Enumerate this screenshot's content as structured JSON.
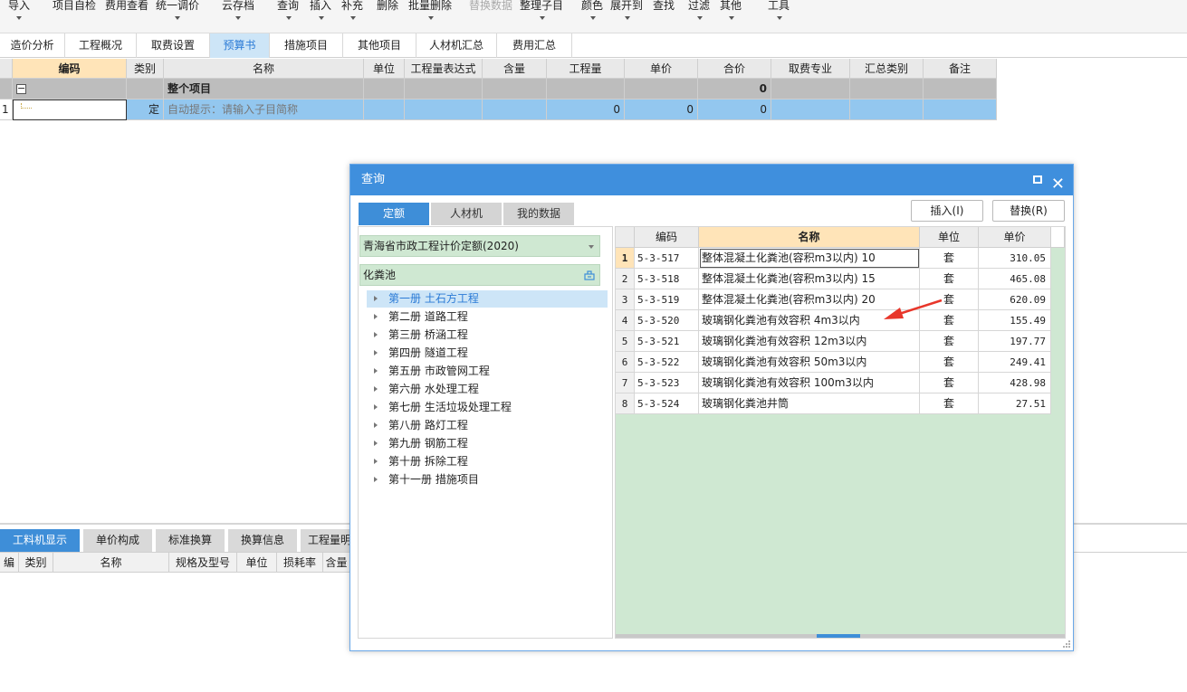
{
  "toolbar": {
    "items": [
      {
        "label": "导入",
        "caret": true
      },
      {
        "label": "项目自检",
        "caret": false
      },
      {
        "label": "费用查看",
        "caret": false
      },
      {
        "label": "统一调价",
        "caret": true
      },
      {
        "label": "云存档",
        "caret": true
      },
      {
        "label": "查询",
        "caret": true
      },
      {
        "label": "插入",
        "caret": true
      },
      {
        "label": "补充",
        "caret": true
      },
      {
        "label": "删除",
        "caret": false
      },
      {
        "label": "批量删除",
        "caret": true
      },
      {
        "label": "替换数据",
        "caret": false,
        "disabled": true
      },
      {
        "label": "整理子目",
        "caret": true
      },
      {
        "label": "颜色",
        "caret": true
      },
      {
        "label": "展开到",
        "caret": true
      },
      {
        "label": "查找",
        "caret": false
      },
      {
        "label": "过滤",
        "caret": true
      },
      {
        "label": "其他",
        "caret": true
      },
      {
        "label": "工具",
        "caret": true
      }
    ]
  },
  "tabs": [
    {
      "label": "造价分析"
    },
    {
      "label": "工程概况"
    },
    {
      "label": "取费设置"
    },
    {
      "label": "预算书",
      "active": true
    },
    {
      "label": "措施项目"
    },
    {
      "label": "其他项目"
    },
    {
      "label": "人材机汇总"
    },
    {
      "label": "费用汇总"
    }
  ],
  "grid": {
    "headers": [
      "编码",
      "类别",
      "名称",
      "单位",
      "工程量表达式",
      "含量",
      "工程量",
      "单价",
      "合价",
      "取费专业",
      "汇总类别",
      "备注"
    ],
    "root_row": {
      "collapse": "−",
      "name": "整个项目",
      "total": "0"
    },
    "row1": {
      "no": "1",
      "type": "定",
      "name": "自动提示：请输入子目简称",
      "qty": "0",
      "price": "0",
      "total": "0"
    }
  },
  "bottom": {
    "tabs": [
      {
        "label": "工料机显示",
        "active": true
      },
      {
        "label": "单价构成"
      },
      {
        "label": "标准换算"
      },
      {
        "label": "换算信息"
      },
      {
        "label": "工程量明细"
      }
    ],
    "headers": [
      "编码",
      "类别",
      "名称",
      "规格及型号",
      "单位",
      "损耗率",
      "含量"
    ]
  },
  "dialog": {
    "title": "查询",
    "tabs": [
      {
        "label": "定额",
        "active": true
      },
      {
        "label": "人材机"
      },
      {
        "label": "我的数据"
      }
    ],
    "insert_btn": "插入(I)",
    "replace_btn": "替换(R)",
    "library": "青海省市政工程计价定额(2020)",
    "search_value": "化粪池",
    "tree": [
      {
        "label": "第一册 土石方工程",
        "selected": true
      },
      {
        "label": "第二册 道路工程"
      },
      {
        "label": "第三册 桥涵工程"
      },
      {
        "label": "第四册 隧道工程"
      },
      {
        "label": "第五册 市政管网工程"
      },
      {
        "label": "第六册 水处理工程"
      },
      {
        "label": "第七册 生活垃圾处理工程"
      },
      {
        "label": "第八册 路灯工程"
      },
      {
        "label": "第九册 钢筋工程"
      },
      {
        "label": "第十册 拆除工程"
      },
      {
        "label": "第十一册 措施项目"
      }
    ],
    "table": {
      "headers": [
        "编码",
        "名称",
        "单位",
        "单价"
      ],
      "rows": [
        {
          "no": "1",
          "code": "5-3-517",
          "name": "整体混凝土化粪池(容积m3以内) 10",
          "unit": "套",
          "price": "310.05"
        },
        {
          "no": "2",
          "code": "5-3-518",
          "name": "整体混凝土化粪池(容积m3以内) 15",
          "unit": "套",
          "price": "465.08"
        },
        {
          "no": "3",
          "code": "5-3-519",
          "name": "整体混凝土化粪池(容积m3以内) 20",
          "unit": "套",
          "price": "620.09"
        },
        {
          "no": "4",
          "code": "5-3-520",
          "name": "玻璃钢化粪池有效容积 4m3以内",
          "unit": "套",
          "price": "155.49"
        },
        {
          "no": "5",
          "code": "5-3-521",
          "name": "玻璃钢化粪池有效容积 12m3以内",
          "unit": "套",
          "price": "197.77"
        },
        {
          "no": "6",
          "code": "5-3-522",
          "name": "玻璃钢化粪池有效容积 50m3以内",
          "unit": "套",
          "price": "249.41"
        },
        {
          "no": "7",
          "code": "5-3-523",
          "name": "玻璃钢化粪池有效容积 100m3以内",
          "unit": "套",
          "price": "428.98"
        },
        {
          "no": "8",
          "code": "5-3-524",
          "name": "玻璃钢化粪池井筒",
          "unit": "套",
          "price": "27.51"
        }
      ]
    }
  },
  "colors": {
    "accent": "#3e8ed8",
    "arrow": "#e8362a",
    "green_bg": "#cfe8d2",
    "header_sel": "#ffe4b8"
  }
}
